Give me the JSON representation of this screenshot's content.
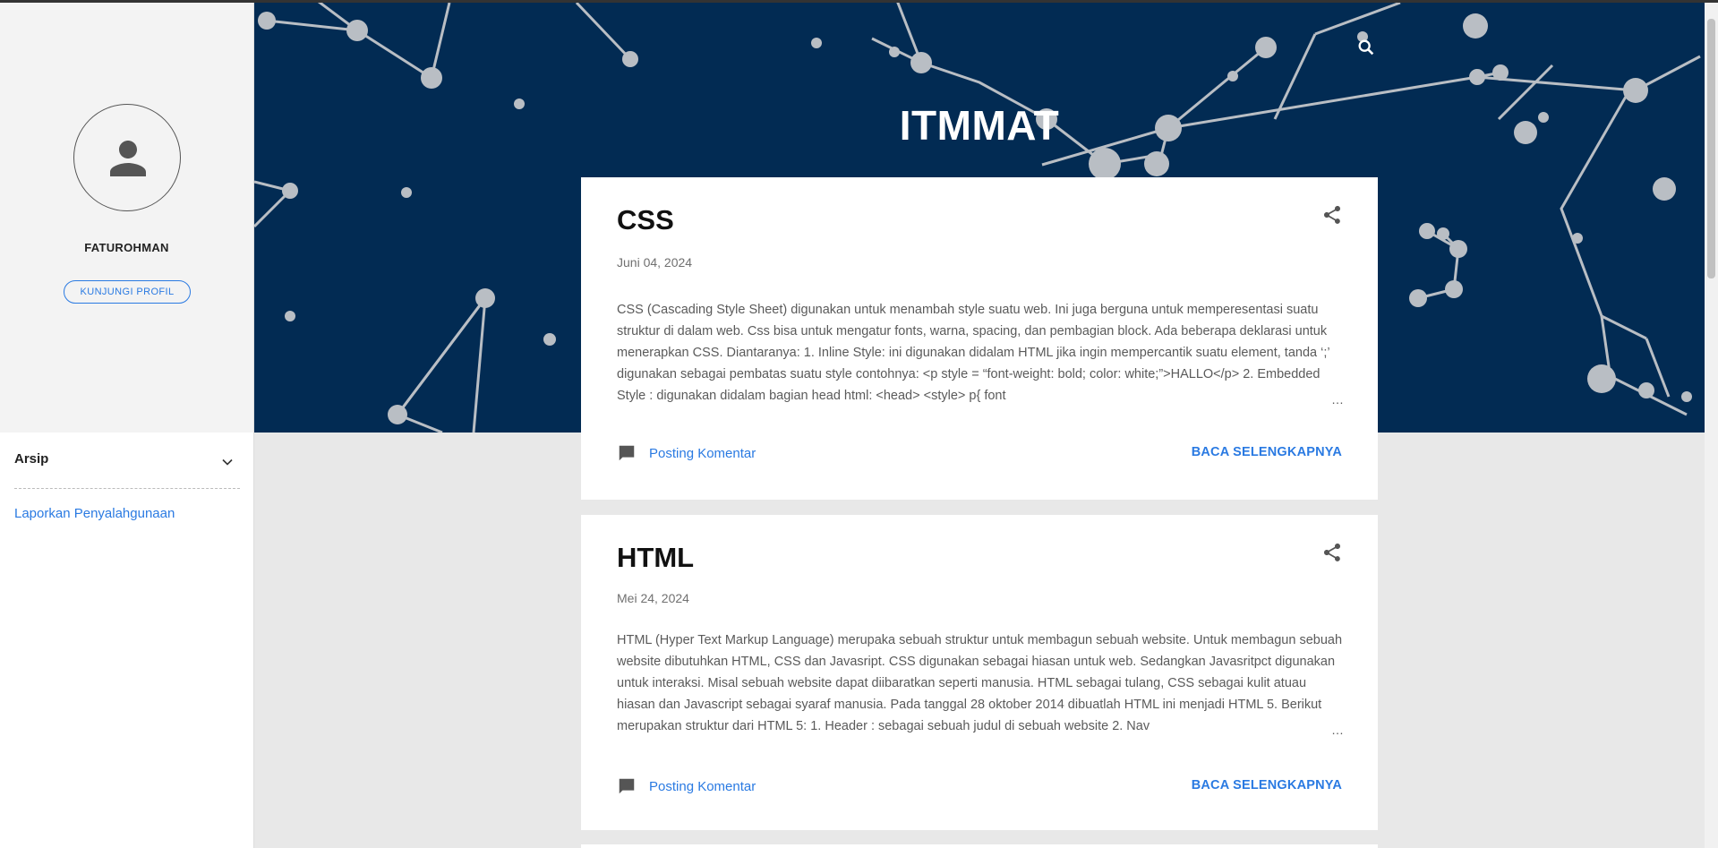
{
  "blog": {
    "title": "ITMMAT"
  },
  "profile": {
    "name": "FATUROHMAN",
    "visit_button": "KUNJUNGI PROFIL"
  },
  "sidebar": {
    "archive_title": "Arsip",
    "report_link": "Laporkan Penyalahgunaan"
  },
  "posts": [
    {
      "title": "CSS",
      "date": "Juni 04, 2024",
      "snippet": "CSS (Cascading Style Sheet) digunakan   untuk menambah   style suatu web. Ini juga berguna untuk memperesentasi suatu struktur di dalam web. Css bisa untuk mengatur fonts, warna, spacing, dan pembagian block. Ada beberapa deklarasi untuk menerapkan CSS. Diantaranya: 1. Inline Style: ini digunakan didalam HTML jika ingin mempercantik suatu element, tanda ‘;’ digunakan sebagai pembatas suatu style contohnya:            <p style = “font-weight: bold; color: white;”>HALLO</p> 2. Embedded Style : digunakan didalam bagian head html:            <head>                      <style> p{ font",
      "comment_label": "Posting Komentar",
      "read_more": "BACA SELENGKAPNYA"
    },
    {
      "title": "HTML",
      "date": "Mei 24, 2024",
      "snippet": "  HTML (Hyper Text Markup Language) merupaka sebuah   struktur untuk membagun sebuah website. Untuk membagun sebuah website dibutuhkan HTML, CSS dan Javasript. CSS digunakan sebagai hiasan untuk web. Sedangkan Javasritpct digunakan untuk interaksi. Misal sebuah website dapat diibaratkan seperti manusia. HTML sebagai tulang, CSS sebagai kulit atuau hiasan dan Javascript sebagai syaraf manusia. Pada tanggal 28 oktober 2014 dibuatlah HTML ini menjadi HTML 5. Berikut merupakan struktur dari HTML 5: 1.       Header :    sebagai sebuah judul   di sebuah   website 2.       Nav",
      "comment_label": "Posting Komentar",
      "read_more": "BACA SELENGKAPNYA"
    }
  ],
  "ellipsis": "…",
  "icons": {
    "search": "search-icon",
    "share": "share-icon",
    "comment": "comment-icon",
    "avatar": "person-icon",
    "chevron": "chevron-down-icon"
  },
  "colors": {
    "header_bg": "#022b53",
    "accent": "#2a7ae2",
    "sidebar_profile_bg": "#f3f3f3",
    "page_bg": "#e8e8e8"
  }
}
